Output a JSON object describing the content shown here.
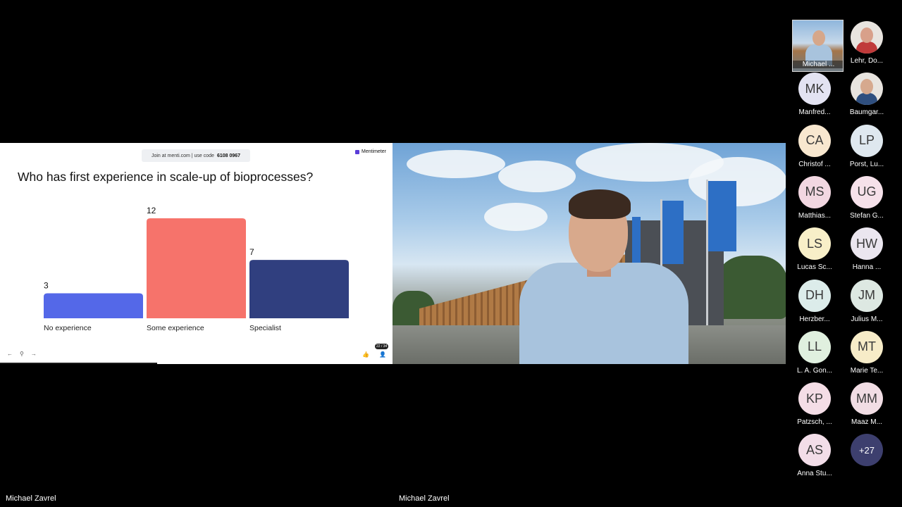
{
  "slide": {
    "join_text": "Join at menti.com | use code",
    "join_code": "6108 0967",
    "brand": "Mentimeter",
    "question": "Who has first experience in scale-up of bioprocesses?",
    "page_counter": "22 / 34",
    "nav_prev": "←",
    "nav_pin": "⚲",
    "nav_next": "→",
    "like_icon": "👍",
    "people_icon": "👤"
  },
  "chart_data": {
    "type": "bar",
    "categories": [
      "No experience",
      "Some experience",
      "Specialist"
    ],
    "values": [
      3,
      12,
      7
    ],
    "colors": [
      "#5468e8",
      "#f6736b",
      "#303f7f"
    ],
    "title": "Who has first experience in scale-up of bioprocesses?",
    "xlabel": "",
    "ylabel": "",
    "grid": false
  },
  "labels": {
    "screen_owner": "Michael Zavrel",
    "video_owner": "Michael Zavrel"
  },
  "participants": [
    {
      "initials": "",
      "name": "Michael ...",
      "type": "self-video"
    },
    {
      "initials": "",
      "name": "Lehr, Do...",
      "type": "photo",
      "skin": "#d8a08a",
      "clothes": "#c03a3a"
    },
    {
      "initials": "MK",
      "name": "Manfred...",
      "bg": "#e3e3f2"
    },
    {
      "initials": "",
      "name": "Baumgar...",
      "type": "photo",
      "skin": "#d6a98e",
      "clothes": "#2f4f7f"
    },
    {
      "initials": "CA",
      "name": "Christof ...",
      "bg": "#f8e7cf"
    },
    {
      "initials": "LP",
      "name": "Porst, Lu...",
      "bg": "#dfe8ef"
    },
    {
      "initials": "MS",
      "name": "Matthias...",
      "bg": "#f2d7e1"
    },
    {
      "initials": "UG",
      "name": "Stefan G...",
      "bg": "#f6e1ea"
    },
    {
      "initials": "LS",
      "name": "Lucas Sc...",
      "bg": "#f8efc8"
    },
    {
      "initials": "HW",
      "name": "Hanna ...",
      "bg": "#ebe6ef"
    },
    {
      "initials": "DH",
      "name": "Herzber...",
      "bg": "#dcecea"
    },
    {
      "initials": "JM",
      "name": "Julius M...",
      "bg": "#dde8e2"
    },
    {
      "initials": "LL",
      "name": "L. A. Gon...",
      "bg": "#e0f0df"
    },
    {
      "initials": "MT",
      "name": "Marie Te...",
      "bg": "#f7ecc8"
    },
    {
      "initials": "KP",
      "name": "Patzsch, ...",
      "bg": "#f4dde6"
    },
    {
      "initials": "MM",
      "name": "Maaz M...",
      "bg": "#f1dde4"
    },
    {
      "initials": "AS",
      "name": "Anna Stu...",
      "bg": "#f2dde8"
    },
    {
      "initials": "+27",
      "name": "",
      "type": "more"
    }
  ]
}
